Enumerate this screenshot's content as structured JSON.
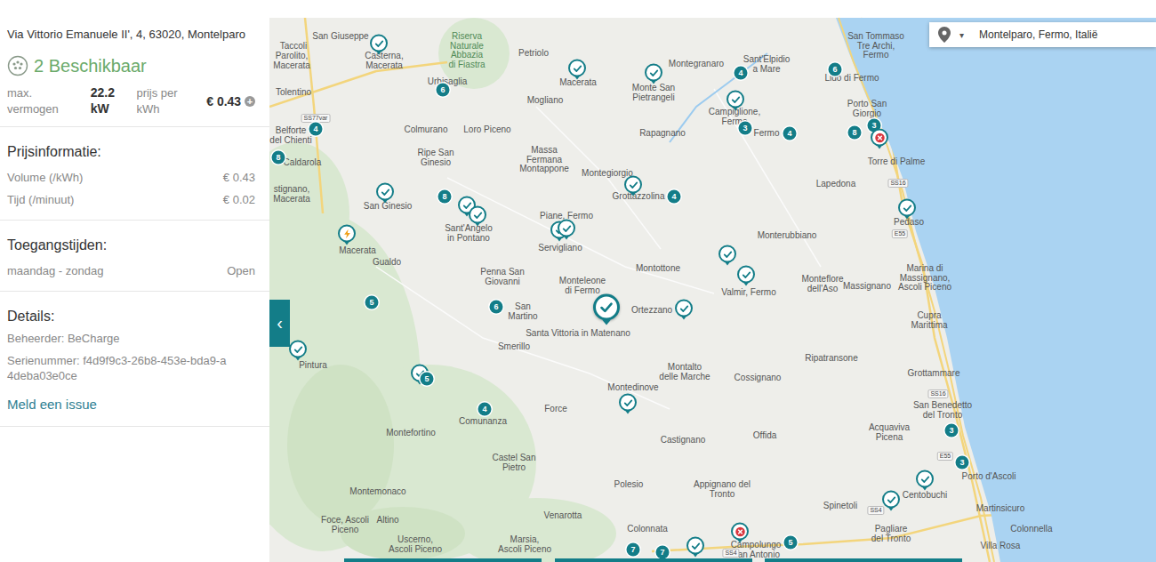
{
  "panel": {
    "address": "Via Vittorio Emanuele II', 4, 63020, Montelparo",
    "status": "2 Beschikbaar",
    "power_label": "max. vermogen",
    "power": "22.2 kW",
    "price_label": "prijs per kWh",
    "price": "€ 0.43",
    "price_info_icon": "+",
    "pricing": {
      "title": "Prijsinformatie:",
      "rows": [
        {
          "label": "Volume (/kWh)",
          "value": "€ 0.43"
        },
        {
          "label": "Tijd (/minuut)",
          "value": "€ 0.02"
        }
      ]
    },
    "hours": {
      "title": "Toegangstijden:",
      "rows": [
        {
          "label": "maandag - zondag",
          "value": "Open"
        }
      ]
    },
    "details": {
      "title": "Details:",
      "operator": "Beheerder: BeCharge",
      "serial": "Serienummer: f4d9f9c3-26b8-453e-bda9-a4deba03e0ce"
    },
    "report_link": "Meld een issue"
  },
  "collapse_button": "‹",
  "search": {
    "caret": "▾",
    "value": "Montelparo, Fermo, Italië"
  },
  "map": {
    "labels": [
      {
        "lines": [
          "Taccoli"
        ]
      },
      {
        "lines": [
          "Parolito,",
          "Macerata"
        ]
      },
      {
        "lines": [
          "San Giuseppe"
        ]
      },
      {
        "lines": [
          "Tolentino"
        ]
      },
      {
        "lines": [
          "Casterna,",
          "Macerata"
        ]
      },
      {
        "lines": [
          "Riserva",
          "Naturale",
          "Abbazia",
          "di Fiastra"
        ]
      },
      {
        "lines": [
          "Petriolo"
        ]
      },
      {
        "lines": [
          "Urbisaglia"
        ]
      },
      {
        "lines": [
          "Macerata"
        ]
      },
      {
        "lines": [
          "Monte San",
          "Pietrangeli"
        ]
      },
      {
        "lines": [
          "Montegranaro"
        ]
      },
      {
        "lines": [
          "Sant'Elpidio",
          "a Mare"
        ]
      },
      {
        "lines": [
          "San Tommaso",
          "Tre Archi,",
          "Fermo"
        ]
      },
      {
        "lines": [
          "Lido di Fermo"
        ]
      },
      {
        "lines": [
          "Porto San",
          "Giorgio"
        ]
      },
      {
        "lines": [
          "Torre di Palme"
        ]
      },
      {
        "lines": [
          "Mogliano"
        ]
      },
      {
        "lines": [
          "Colmurano"
        ]
      },
      {
        "lines": [
          "Loro Piceno"
        ]
      },
      {
        "lines": [
          "Rapagnano"
        ]
      },
      {
        "lines": [
          "Campiglione,",
          "Fermo"
        ]
      },
      {
        "lines": [
          "Fermo"
        ]
      },
      {
        "lines": [
          "Belforte",
          "del Chienti"
        ]
      },
      {
        "lines": [
          "Caldarola"
        ]
      },
      {
        "lines": [
          "Ripe San",
          "Ginesio"
        ]
      },
      {
        "lines": [
          "Massa",
          "Fermana",
          "Montappone"
        ]
      },
      {
        "lines": [
          "Montegiorgio"
        ]
      },
      {
        "lines": [
          "Grottazzolina"
        ]
      },
      {
        "lines": [
          "Lapedona"
        ]
      },
      {
        "lines": [
          "Pedaso"
        ]
      },
      {
        "lines": [
          "stignano,",
          "Macerata"
        ]
      },
      {
        "lines": [
          "San Ginesio"
        ]
      },
      {
        "lines": [
          "Sant'Angelo",
          "in Pontano"
        ]
      },
      {
        "lines": [
          "Piane, Fermo"
        ]
      },
      {
        "lines": [
          "Servigliano"
        ]
      },
      {
        "lines": [
          "Monterubbiano"
        ]
      },
      {
        "lines": [
          "Macerata"
        ]
      },
      {
        "lines": [
          "Gualdo"
        ]
      },
      {
        "lines": [
          "Penna San",
          "Giovanni"
        ]
      },
      {
        "lines": [
          "Montottone"
        ]
      },
      {
        "lines": [
          "Valmir, Fermo"
        ]
      },
      {
        "lines": [
          "Monteflore",
          "dell'Aso"
        ]
      },
      {
        "lines": [
          "Massignano"
        ]
      },
      {
        "lines": [
          "Marina di",
          "Massignano,",
          "Ascoli Piceno"
        ]
      },
      {
        "lines": [
          "Monteleone",
          "di Fermo"
        ]
      },
      {
        "lines": [
          "San",
          "Martino"
        ]
      },
      {
        "lines": [
          "Santa Vittoria in Matenano"
        ]
      },
      {
        "lines": [
          "Ortezzano"
        ]
      },
      {
        "lines": [
          "Cupra",
          "Marittima"
        ]
      },
      {
        "lines": [
          "Pintura"
        ]
      },
      {
        "lines": [
          "Smerillo"
        ]
      },
      {
        "lines": [
          "Ripatransone"
        ]
      },
      {
        "lines": [
          "Montalto",
          "delle Marche"
        ]
      },
      {
        "lines": [
          "Cossignano"
        ]
      },
      {
        "lines": [
          "Grottammare"
        ]
      },
      {
        "lines": [
          "Montedinove"
        ]
      },
      {
        "lines": [
          "Comunanza"
        ]
      },
      {
        "lines": [
          "Force"
        ]
      },
      {
        "lines": [
          "Castignano"
        ]
      },
      {
        "lines": [
          "Offida"
        ]
      },
      {
        "lines": [
          "Acquaviva",
          "Picena"
        ]
      },
      {
        "lines": [
          "San Benedetto",
          "del Tronto"
        ]
      },
      {
        "lines": [
          "Montefortino"
        ]
      },
      {
        "lines": [
          "Castel San",
          "Pietro"
        ]
      },
      {
        "lines": [
          "Polesio"
        ]
      },
      {
        "lines": [
          "Appignano del",
          "Tronto"
        ]
      },
      {
        "lines": [
          "Spinetoli"
        ]
      },
      {
        "lines": [
          "Porto d'Ascoli"
        ]
      },
      {
        "lines": [
          "Centobuchi"
        ]
      },
      {
        "lines": [
          "Martinsicuro"
        ]
      },
      {
        "lines": [
          "Montemonaco"
        ]
      },
      {
        "lines": [
          "Venarotta"
        ]
      },
      {
        "lines": [
          "Pagliare",
          "del Tronto"
        ]
      },
      {
        "lines": [
          "Colonnella"
        ]
      },
      {
        "lines": [
          "Foce, Ascoli",
          "Piceno"
        ]
      },
      {
        "lines": [
          "Altino"
        ]
      },
      {
        "lines": [
          "Colonnata"
        ]
      },
      {
        "lines": [
          "Uscerno,",
          "Ascoli Piceno"
        ]
      },
      {
        "lines": [
          "Marsia,",
          "Ascoli Piceno"
        ]
      },
      {
        "lines": [
          "Campolungo",
          "San Antonio"
        ]
      },
      {
        "lines": [
          "Villa Rosa"
        ]
      }
    ],
    "roads": [
      {
        "text": "SS77var"
      },
      {
        "text": "SS16"
      },
      {
        "text": "E55"
      },
      {
        "text": "SS16"
      },
      {
        "text": "E55"
      },
      {
        "text": "SS4"
      },
      {
        "text": "SS4"
      }
    ],
    "pins": [
      {
        "kind": "available",
        "selected": false
      },
      {
        "kind": "available",
        "selected": false
      },
      {
        "kind": "available",
        "selected": false
      },
      {
        "kind": "available",
        "selected": false
      },
      {
        "kind": "available",
        "selected": false
      },
      {
        "kind": "available",
        "selected": false
      },
      {
        "kind": "available",
        "selected": false
      },
      {
        "kind": "available",
        "selected": false
      },
      {
        "kind": "available",
        "selected": false
      },
      {
        "kind": "available",
        "selected": false
      },
      {
        "kind": "available",
        "selected": false
      },
      {
        "kind": "available",
        "selected": false
      },
      {
        "kind": "available",
        "selected": false
      },
      {
        "kind": "available",
        "selected": true
      },
      {
        "kind": "available",
        "selected": false
      },
      {
        "kind": "available",
        "selected": false
      },
      {
        "kind": "available",
        "selected": false
      },
      {
        "kind": "available",
        "selected": false
      },
      {
        "kind": "available",
        "selected": false
      },
      {
        "kind": "available",
        "selected": false
      },
      {
        "kind": "available",
        "selected": false
      },
      {
        "kind": "cluster",
        "count": "6",
        "selected": false
      },
      {
        "kind": "cluster",
        "count": "4",
        "selected": false
      },
      {
        "kind": "cluster",
        "count": "8",
        "selected": false
      },
      {
        "kind": "cluster",
        "count": "4",
        "selected": false
      },
      {
        "kind": "cluster",
        "count": "6",
        "selected": false
      },
      {
        "kind": "cluster",
        "count": "3",
        "selected": false
      },
      {
        "kind": "cluster",
        "count": "4",
        "selected": false
      },
      {
        "kind": "cluster",
        "count": "8",
        "selected": false
      },
      {
        "kind": "cluster",
        "count": "3",
        "selected": false
      },
      {
        "kind": "cluster",
        "count": "8",
        "selected": false
      },
      {
        "kind": "cluster",
        "count": "4",
        "selected": false
      },
      {
        "kind": "cluster",
        "count": "5",
        "selected": false
      },
      {
        "kind": "cluster",
        "count": "6",
        "selected": false
      },
      {
        "kind": "cluster",
        "count": "5",
        "selected": false
      },
      {
        "kind": "cluster",
        "count": "4",
        "selected": false
      },
      {
        "kind": "cluster",
        "count": "3",
        "selected": false
      },
      {
        "kind": "cluster",
        "count": "3",
        "selected": false
      },
      {
        "kind": "cluster",
        "count": "5",
        "selected": false
      },
      {
        "kind": "cluster",
        "count": "7",
        "selected": false
      },
      {
        "kind": "cluster",
        "count": "7",
        "selected": false
      },
      {
        "kind": "unavailable",
        "selected": false
      },
      {
        "kind": "unavailable",
        "selected": false
      },
      {
        "kind": "charging",
        "selected": false
      }
    ]
  }
}
